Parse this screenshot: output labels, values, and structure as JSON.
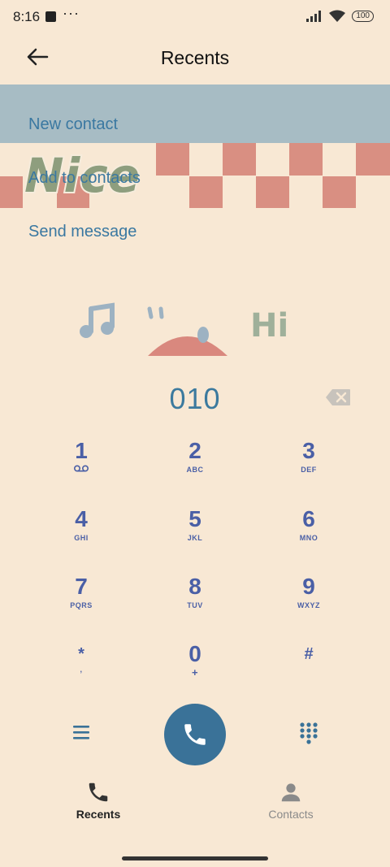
{
  "status_bar": {
    "time": "8:16",
    "more": "···",
    "battery": "100"
  },
  "header": {
    "title": "Recents"
  },
  "menu": {
    "items": [
      "New contact",
      "Add to contacts",
      "Send message"
    ]
  },
  "dialer": {
    "number": "010"
  },
  "keypad": [
    {
      "digit": "1",
      "letters": ""
    },
    {
      "digit": "2",
      "letters": "ABC"
    },
    {
      "digit": "3",
      "letters": "DEF"
    },
    {
      "digit": "4",
      "letters": "GHI"
    },
    {
      "digit": "5",
      "letters": "JKL"
    },
    {
      "digit": "6",
      "letters": "MNO"
    },
    {
      "digit": "7",
      "letters": "PQRS"
    },
    {
      "digit": "8",
      "letters": "TUV"
    },
    {
      "digit": "9",
      "letters": "WXYZ"
    },
    {
      "digit": "*",
      "letters": ","
    },
    {
      "digit": "0",
      "letters": "+"
    },
    {
      "digit": "#",
      "letters": ""
    }
  ],
  "tabs": {
    "recents": "Recents",
    "contacts": "Contacts"
  },
  "decor_text": {
    "nice": "Nice",
    "hi": "Hi"
  },
  "colors": {
    "background": "#f8e8d4",
    "accent": "#3a7298",
    "keypad_text": "#4a5fa6",
    "link": "#3a78a1"
  },
  "icons": [
    "back-arrow-icon",
    "backspace-icon",
    "voicemail-icon",
    "menu-icon",
    "phone-icon",
    "dialpad-icon",
    "person-icon"
  ]
}
